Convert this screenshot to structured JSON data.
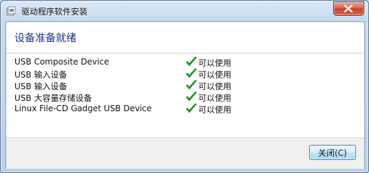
{
  "window": {
    "title": "驱动程序软件安装"
  },
  "icons": {
    "app": "driver-install-icon",
    "close": "close-icon",
    "status": "green-check-icon"
  },
  "colors": {
    "heading": "#1e3287",
    "check": "#2e9e2e",
    "close_button": "#c8432a"
  },
  "main": {
    "heading": "设备准备就绪",
    "devices": [
      {
        "name": "USB Composite Device",
        "status": "可以使用"
      },
      {
        "name": "USB 输入设备",
        "status": "可以使用"
      },
      {
        "name": "USB 输入设备",
        "status": "可以使用"
      },
      {
        "name": "USB 大容量存储设备",
        "status": "可以使用"
      },
      {
        "name": "Linux File-CD Gadget USB Device",
        "status": "可以使用"
      }
    ]
  },
  "footer": {
    "close_label": "关闭(C)"
  }
}
